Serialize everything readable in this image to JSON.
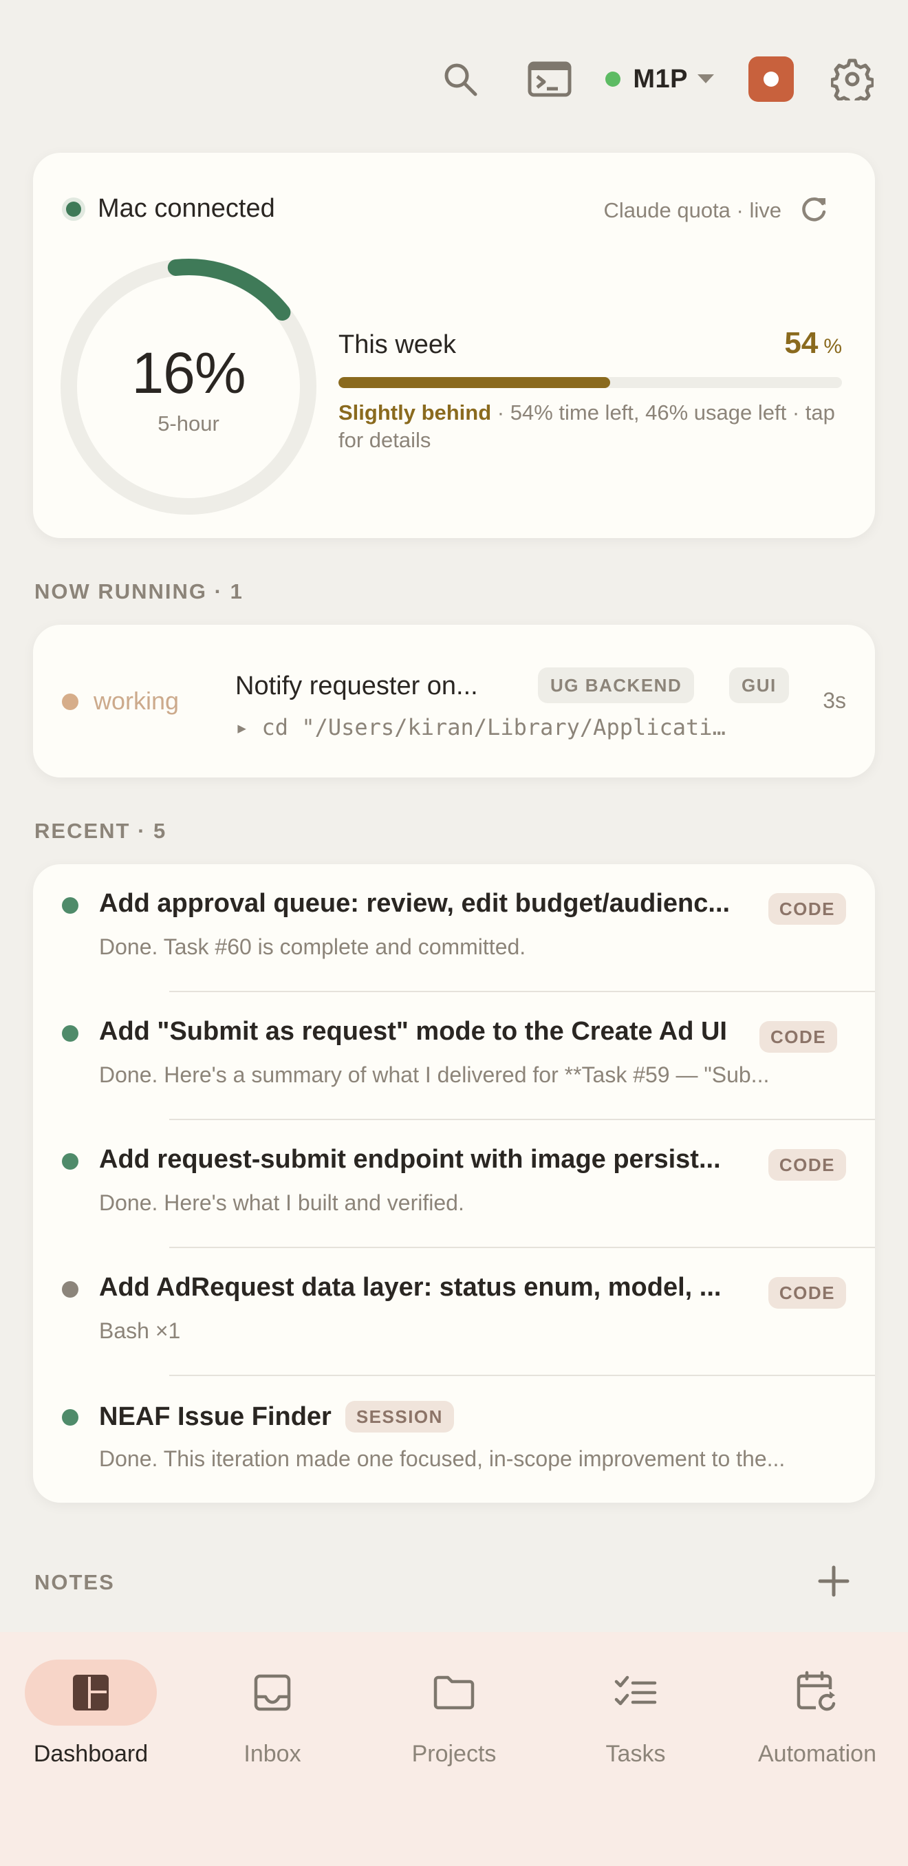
{
  "header": {
    "host_name": "M1P",
    "icons": [
      "search-icon",
      "terminal-icon",
      "chevron-down-icon",
      "record-icon",
      "gear-icon"
    ]
  },
  "quota": {
    "connection_label": "Mac connected",
    "live_label": "Claude quota · live",
    "five_hour_percent": 16,
    "five_hour_value": "16%",
    "five_hour_label": "5-hour",
    "week_title": "This week",
    "week_percent": 54,
    "week_value": "54",
    "week_unit": "%",
    "week_status": "Slightly behind",
    "week_detail": " · 54% time left, 46% usage left · tap for details"
  },
  "running": {
    "section_label": "NOW RUNNING · 1",
    "items": [
      {
        "state": "working",
        "title": "Notify requester on...",
        "tags": [
          "UG BACKEND",
          "GUI"
        ],
        "duration": "3s",
        "command": "▸ cd \"/Users/kiran/Library/Applicati…"
      }
    ]
  },
  "recent": {
    "section_label": "RECENT · 5",
    "items": [
      {
        "title": "Add approval queue: review, edit budget/audienc...",
        "tag": "CODE",
        "subtitle": "Done. Task #60 is complete and committed.",
        "status_color": "#4F8B6A"
      },
      {
        "title": "Add \"Submit as request\" mode to the Create Ad UI",
        "tag": "CODE",
        "subtitle": "Done. Here's a summary of what I delivered for **Task #59 — \"Sub...",
        "status_color": "#4F8B6A"
      },
      {
        "title": "Add request-submit endpoint with image persist...",
        "tag": "CODE",
        "subtitle": "Done. Here's what I built and verified.",
        "status_color": "#4F8B6A"
      },
      {
        "title": "Add AdRequest data layer: status enum, model, ...",
        "tag": "CODE",
        "subtitle": "Bash ×1",
        "status_color": "#8C857B"
      },
      {
        "title": "NEAF Issue Finder",
        "tag": "SESSION",
        "subtitle": "Done. This iteration made one focused, in-scope improvement to the...",
        "status_color": "#4F8B6A"
      }
    ]
  },
  "notes": {
    "section_label": "NOTES"
  },
  "nav": {
    "items": [
      {
        "label": "Dashboard",
        "icon": "dashboard-icon",
        "active": true
      },
      {
        "label": "Inbox",
        "icon": "inbox-icon",
        "active": false
      },
      {
        "label": "Projects",
        "icon": "folder-icon",
        "active": false
      },
      {
        "label": "Tasks",
        "icon": "tasks-icon",
        "active": false
      },
      {
        "label": "Automation",
        "icon": "calendar-refresh-icon",
        "active": false
      }
    ]
  },
  "colors": {
    "accent_green": "#3F7A58",
    "accent_gold": "#8A6A1E",
    "record_red": "#C8613D",
    "host_online": "#5DBB63"
  }
}
